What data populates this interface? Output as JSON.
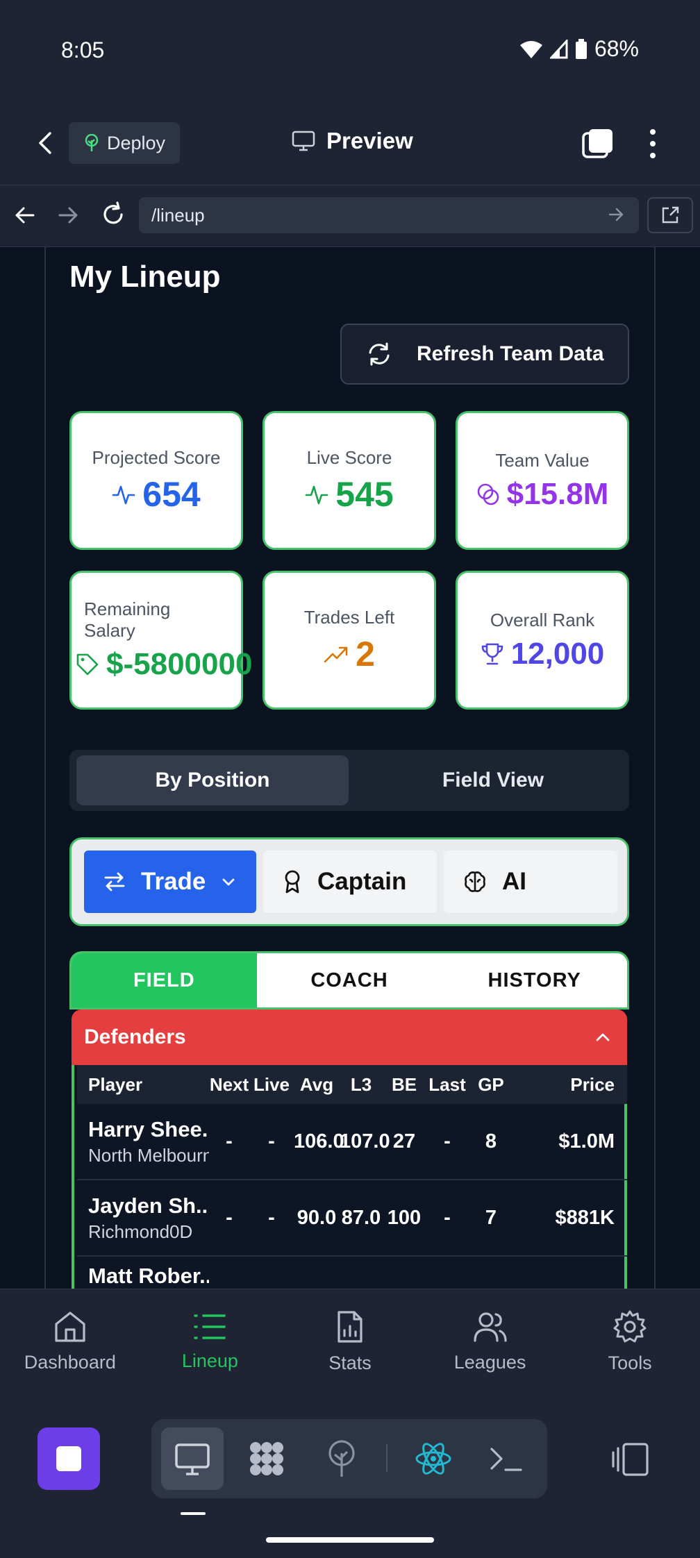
{
  "status": {
    "time": "8:05",
    "battery": "68%"
  },
  "header": {
    "deploy_label": "Deploy",
    "title": "Preview"
  },
  "browser": {
    "url": "/lineup"
  },
  "page": {
    "title": "My Lineup",
    "refresh_label": "Refresh Team Data",
    "stats": {
      "projected": {
        "label": "Projected Score",
        "value": "654"
      },
      "live": {
        "label": "Live Score",
        "value": "545"
      },
      "team_value": {
        "label": "Team Value",
        "value": "$15.8M"
      },
      "remaining": {
        "label": "Remaining Salary",
        "value": "$-5800000"
      },
      "trades": {
        "label": "Trades Left",
        "value": "2"
      },
      "rank": {
        "label": "Overall Rank",
        "value": "12,000"
      }
    },
    "view_toggle": {
      "active": "By Position",
      "other": "Field View"
    },
    "actions": {
      "trade": "Trade",
      "captain": "Captain",
      "ai": "AI"
    },
    "tabs": [
      "FIELD",
      "COACH",
      "HISTORY"
    ],
    "section": "Defenders",
    "table": {
      "headers": [
        "Player",
        "Next",
        "Live",
        "Avg",
        "L3",
        "BE",
        "Last",
        "GP",
        "Price"
      ],
      "rows": [
        {
          "name": "Harry Shee...",
          "team": "North Melbourn",
          "next": "-",
          "live": "-",
          "avg": "106.0",
          "l3": "107.0",
          "be": "27",
          "last": "-",
          "gp": "8",
          "price": "$1.0M"
        },
        {
          "name": "Jayden Sh...",
          "team": "Richmond0D",
          "next": "-",
          "live": "-",
          "avg": "90.0",
          "l3": "87.0",
          "be": "100",
          "last": "-",
          "gp": "7",
          "price": "$881K"
        },
        {
          "name": "Matt Rober...",
          "team": "",
          "next": "",
          "live": "",
          "avg": "",
          "l3": "",
          "be": "",
          "last": "",
          "gp": "",
          "price": ""
        }
      ]
    }
  },
  "tabbar": [
    "Dashboard",
    "Lineup",
    "Stats",
    "Leagues",
    "Tools"
  ],
  "colors": {
    "accent_green": "#22c55e",
    "trade_blue": "#2563eb",
    "danger_red": "#e53e3e",
    "projected_blue": "#2563eb",
    "live_green": "#16a34a",
    "value_purple": "#9333ea",
    "trades_orange": "#d97706",
    "rank_indigo": "#4f46e5",
    "stop_purple": "#6d3ee8"
  }
}
